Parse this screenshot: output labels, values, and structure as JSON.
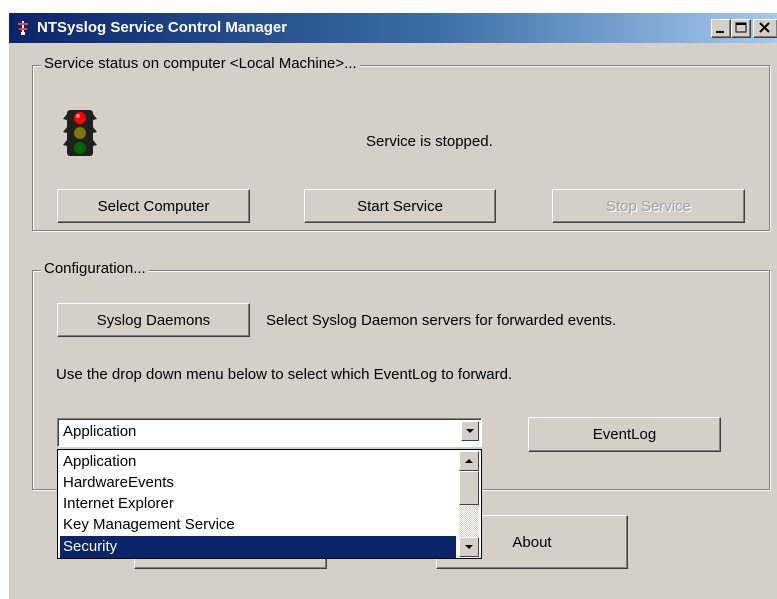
{
  "window": {
    "title": "NTSyslog Service Control Manager"
  },
  "status_group": {
    "label": "Service status on computer <Local Machine>...",
    "status_text": "Service is stopped.",
    "buttons": {
      "select_computer": "Select Computer",
      "start_service": "Start Service",
      "stop_service": "Stop Service"
    }
  },
  "config_group": {
    "label": "Configuration...",
    "syslog_button": "Syslog Daemons",
    "syslog_description": "Select Syslog Daemon servers for forwarded events.",
    "instruction": "Use the drop down menu below to select which EventLog to forward.",
    "eventlog_combo": {
      "selected": "Application",
      "options": [
        "Application",
        "HardwareEvents",
        "Internet Explorer",
        "Key Management Service",
        "Security"
      ],
      "highlighted": "Security"
    },
    "eventlog_button": "EventLog"
  },
  "footer": {
    "about_button": "About"
  },
  "colors": {
    "title_gradient_start": "#0a246a",
    "title_gradient_end": "#a6caf0",
    "face": "#d4d0c8",
    "selection": "#0a246a",
    "light_red": "#ff0000",
    "light_yellow": "#7a7a00",
    "light_green": "#006400"
  },
  "icons": {
    "app": "tower-icon",
    "traffic_light": "traffic-light-icon"
  }
}
